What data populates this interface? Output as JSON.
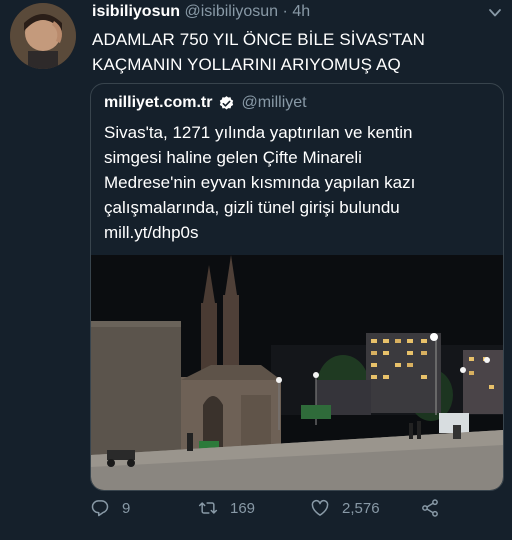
{
  "tweet": {
    "display_name": "isibiliyosun",
    "handle": "@isibiliyosun",
    "separator": "·",
    "time": "4h",
    "text_line1": "ADAMLAR 750 YIL ÖNCE BİLE SİVAS'TAN",
    "text_line2": "KAÇMANIN YOLLARINI ARIYOMUŞ AQ"
  },
  "quoted": {
    "site_name": "milliyet.com.tr",
    "handle": "@milliyet",
    "verified_icon": "verified-badge-icon",
    "text_line1": "Sivas'ta, 1271 yılında yaptırılan ve kentin",
    "text_line2": "simgesi haline gelen Çifte Minareli",
    "text_line3": "Medrese'nin eyvan kısmında yapılan kazı",
    "text_line4": "çalışmalarında, gizli tünel girişi bulundu",
    "text_line5": "mill.yt/dhp0s"
  },
  "actions": {
    "reply_count": "9",
    "retweet_count": "169",
    "like_count": "2,576"
  },
  "colors": {
    "background": "#15202b",
    "secondary_text": "#8899a6",
    "border": "#38444d",
    "verified": "#1da1f2"
  }
}
